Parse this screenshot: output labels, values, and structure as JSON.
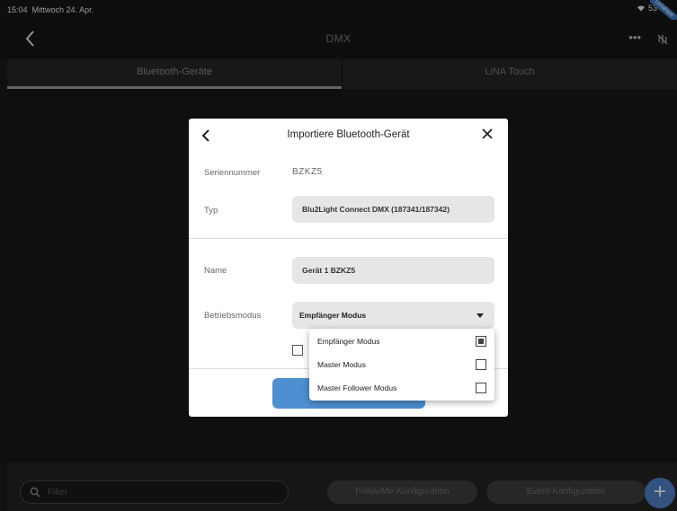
{
  "status_bar": {
    "time": "15:04",
    "date": "Mittwoch 24. Apr.",
    "battery": "53",
    "badge": "Unfallapp"
  },
  "nav": {
    "title": "DMX",
    "more": "•••"
  },
  "tabs": [
    {
      "label": "Bluetooth-Geräte",
      "active": true
    },
    {
      "label": "LiNA Touch",
      "active": false
    }
  ],
  "bottom_bar": {
    "filter_placeholder": "Filter",
    "followme_label": "FollowMe Konfiguration",
    "event_label": "Event-Konfiguration",
    "add_label": "+"
  },
  "dialog": {
    "title": "Importiere Bluetooth-Gerät",
    "serial_label": "Seriennummer",
    "serial_value": "BZKZ5",
    "type_label": "Typ",
    "type_value": "Blu2Light Connect DMX (187341/187342)",
    "name_label": "Name",
    "name_value": "Gerät 1 BZKZ5",
    "mode_label": "Betriebsmodus",
    "mode_value": "Empfänger Modus"
  },
  "dropdown": {
    "options": [
      {
        "label": "Empfänger Modus",
        "checked": true
      },
      {
        "label": "Master Modus",
        "checked": false
      },
      {
        "label": "Master Follower Modus",
        "checked": false
      }
    ]
  },
  "colors": {
    "accent": "#4d8fd0",
    "fab": "#4d7fc4"
  }
}
